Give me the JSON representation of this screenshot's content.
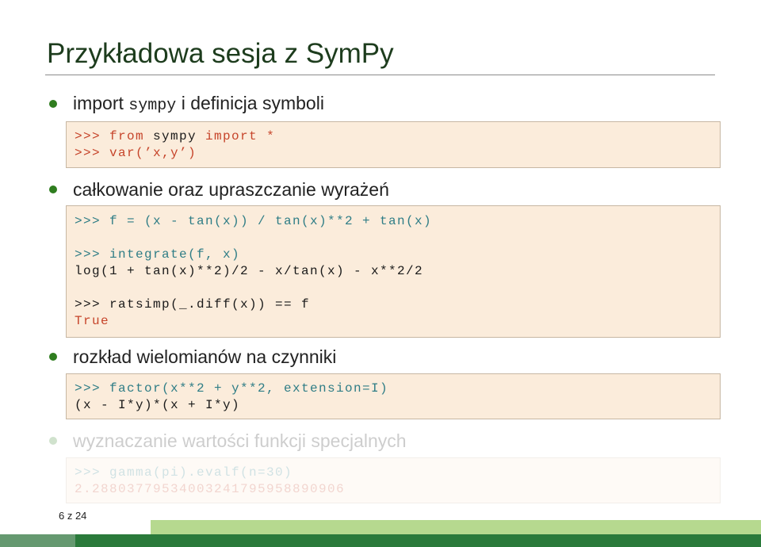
{
  "slide": {
    "title": "Przykładowa sesja z SymPy",
    "page_label": "6 z 24"
  },
  "bullets": [
    {
      "pre": "import ",
      "mono": "sympy",
      "post": " i definicja symboli"
    },
    {
      "text": "całkowanie oraz upraszczanie wyrażeń"
    },
    {
      "text": "rozkład wielomianów na czynniki"
    },
    {
      "text": "wyznaczanie wartości funkcji specjalnych"
    }
  ],
  "code": {
    "block1": {
      "l1": {
        "p": ">>> ",
        "kw1": "from",
        "mid": " sympy ",
        "kw2": "import",
        "star": " *"
      },
      "l2": {
        "p": ">>> ",
        "fn": "var",
        "rest": "(’x,y’)"
      }
    },
    "block2": {
      "l1": ">>> f = (x - tan(x)) / tan(x)**2 + tan(x)",
      "l2": ">>> integrate(f, x)",
      "l3": "log(1 + tan(x)**2)/2 - x/tan(x) - x**2/2",
      "l4": ">>> ratsimp(_.diff(x)) == f",
      "l5": "True"
    },
    "block3": {
      "l1": ">>> factor(x**2 + y**2, extension=I)",
      "l2": "(x - I*y)*(x + I*y)"
    },
    "block4": {
      "l1": ">>> gamma(pi).evalf(n=30)",
      "l2": "2.28803779534003241795958890906"
    }
  },
  "colors": {
    "bullet": "#2f7d1f",
    "code_bg": "#fbecdb",
    "footer_dark": "#2a7a3b",
    "footer_light": "#b6d98f"
  }
}
